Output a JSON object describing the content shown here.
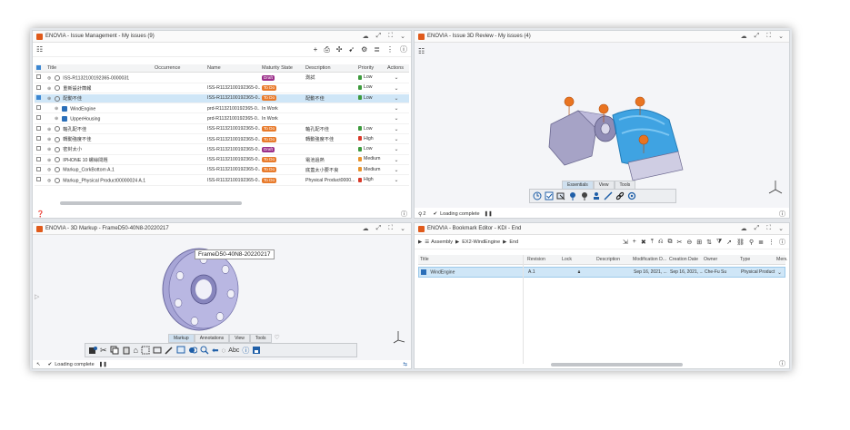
{
  "issue_panel": {
    "title": "ENOVIA - Issue Management - My issues (9)",
    "columns": [
      "Title",
      "Occurrence",
      "Name",
      "Maturity State",
      "Description",
      "Priority",
      "Actions"
    ],
    "rows": [
      {
        "title": "ISS-R1132100192365-0000031",
        "name": "",
        "state": "Draft",
        "desc": "測試",
        "priority": "Low",
        "prio_color": "#3d9a3d",
        "indent": 0,
        "selected": false
      },
      {
        "title": "重新設計簡報",
        "name": "ISS-R1132100192365-0...",
        "state": "To Do",
        "desc": "",
        "priority": "Low",
        "prio_color": "#3d9a3d",
        "indent": 0,
        "selected": false
      },
      {
        "title": "配動不佳",
        "name": "ISS-R1132100192365-0...",
        "state": "To Do",
        "desc": "配動不佳",
        "priority": "Low",
        "prio_color": "#3d9a3d",
        "indent": 0,
        "selected": true
      },
      {
        "title": "WindEngine",
        "name": "prd-R1132100192365-0...",
        "state": "In Work",
        "desc": "",
        "priority": "",
        "prio_color": "",
        "indent": 1,
        "selected": false
      },
      {
        "title": "UpperHousing",
        "name": "prd-R1132100192365-0...",
        "state": "In Work",
        "desc": "",
        "priority": "",
        "prio_color": "",
        "indent": 1,
        "selected": false
      },
      {
        "title": "軸孔配不佳",
        "name": "ISS-R1132100192365-0...",
        "state": "To Do",
        "desc": "軸孔配不佳",
        "priority": "Low",
        "prio_color": "#3d9a3d",
        "indent": 0,
        "selected": false
      },
      {
        "title": "轉動強度不佳",
        "name": "ISS-R1132100192365-0...",
        "state": "To Do",
        "desc": "轉動強度不佳",
        "priority": "High",
        "prio_color": "#d83a2a",
        "indent": 0,
        "selected": false
      },
      {
        "title": "密封太小",
        "name": "ISS-R1132100192365-0...",
        "state": "Draft",
        "desc": "",
        "priority": "Low",
        "prio_color": "#3d9a3d",
        "indent": 0,
        "selected": false
      },
      {
        "title": "IPHONE 10 螺絲問題",
        "name": "ISS-R1132100192365-0...",
        "state": "To Do",
        "desc": "電池過熱",
        "priority": "Medium",
        "prio_color": "#e8932c",
        "indent": 0,
        "selected": false
      },
      {
        "title": "Markup_CorkBottom A.1",
        "name": "ISS-R1132100192365-0...",
        "state": "To Do",
        "desc": "底蓋太小要不良",
        "priority": "Medium",
        "prio_color": "#e8932c",
        "indent": 0,
        "selected": false
      },
      {
        "title": "Markup_Physical Product00000024 A.1",
        "name": "ISS-R1132100192365-0...",
        "state": "To Do",
        "desc": "Physical Product0000...",
        "priority": "High",
        "prio_color": "#d83a2a",
        "indent": 0,
        "selected": false
      }
    ]
  },
  "review_panel": {
    "title": "ENOVIA - Issue 3D Review - My issues (4)",
    "tabs": [
      "Essentials",
      "View",
      "Tools"
    ],
    "status": "Loading complete",
    "count": "2"
  },
  "markup_panel": {
    "title": "ENOVIA - 3D Markup - FrameD50-40N8-20220217",
    "label": "FrameD50-40N8-20220217",
    "tabs": [
      "Markup",
      "Annotations",
      "View",
      "Tools"
    ],
    "status": "Loading complete"
  },
  "bookmark_panel": {
    "title": "ENOVIA - Bookmark Editor - KDI - End",
    "breadcrumb": [
      "Assembly",
      "EX2-WindEngine",
      "End"
    ],
    "columns": [
      "Title",
      "Revision",
      "Lock",
      "Description",
      "Modification D...",
      "Creation Date",
      "Owner",
      "Type",
      "Menu"
    ],
    "row": {
      "title": "WindEngine",
      "revision": "A.1",
      "lock": "",
      "description": "",
      "modified": "Sep 16, 2021, ...",
      "created": "Sep 16, 2021, ...",
      "owner": "Che-Fu Su",
      "type": "Physical Product"
    }
  },
  "colors": {
    "accent": "#1e73be",
    "draft": "#9b2f8a",
    "todo": "#e87b2c",
    "selection": "#cfe6f7"
  }
}
